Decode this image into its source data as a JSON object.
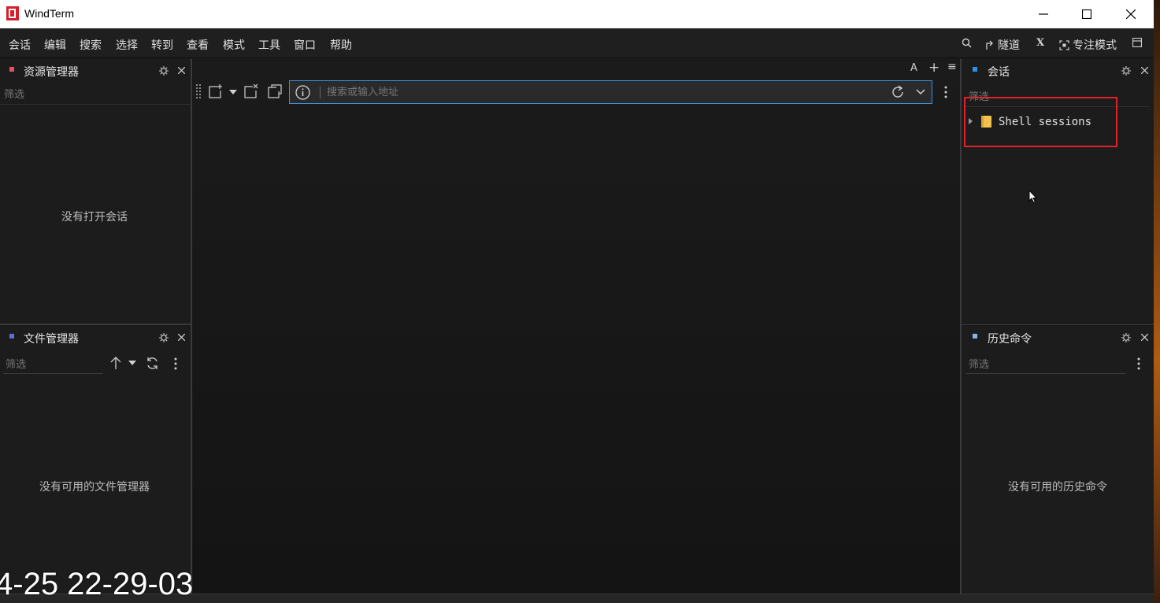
{
  "window": {
    "title": "WindTerm"
  },
  "menu": {
    "items": [
      "会话",
      "编辑",
      "搜索",
      "选择",
      "转到",
      "查看",
      "模式",
      "工具",
      "窗口",
      "帮助"
    ],
    "tunnel_label": "隧道",
    "x_label": "X",
    "focus_mode_label": "专注模式"
  },
  "explorer_panel": {
    "title": "资源管理器",
    "filter_placeholder": "筛选",
    "empty_message": "没有打开会话"
  },
  "file_manager_panel": {
    "title": "文件管理器",
    "filter_placeholder": "筛选",
    "empty_message": "没有可用的文件管理器"
  },
  "main_area": {
    "corner_font_label": "A",
    "corner_plus_label": "+",
    "corner_menu_label": "≡",
    "address_placeholder": "搜索或输入地址"
  },
  "session_panel": {
    "title": "会话",
    "filter_placeholder": "筛选",
    "tree": [
      {
        "label": "Shell sessions",
        "expanded": false
      }
    ]
  },
  "history_panel": {
    "title": "历史命令",
    "filter_placeholder": "筛选",
    "empty_message": "没有可用的历史命令"
  },
  "overlay_timestamp": "4-25 22-29-03",
  "colors": {
    "explorer_dot": "#e05561",
    "file_manager_dot": "#5b6fd6",
    "session_dot": "#2f8fe8",
    "history_dot": "#8ab4e8",
    "address_border": "#3d8fdc",
    "highlight_box": "#e0222a",
    "folder": "#f2c14e"
  }
}
